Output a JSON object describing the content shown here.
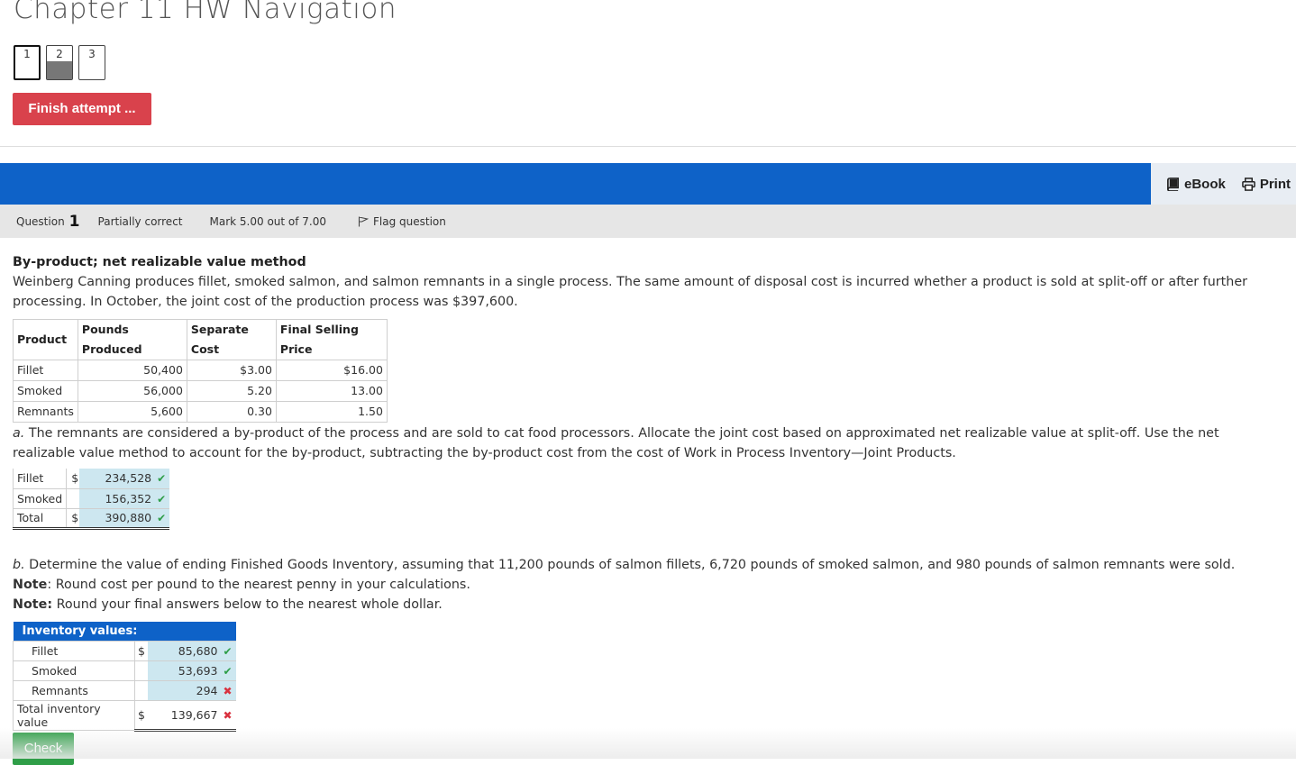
{
  "navigation": {
    "title": "Chapter 11 HW Navigation",
    "buttons": [
      "1",
      "2",
      "3"
    ],
    "finish_label": "Finish attempt ..."
  },
  "tools": {
    "ebook": "eBook",
    "print": "Print"
  },
  "question_info": {
    "label": "Question",
    "number": "1",
    "status": "Partially correct",
    "mark": "Mark 5.00 out of 7.00",
    "flag": "Flag question"
  },
  "question": {
    "heading": "By-product; net realizable value method",
    "text": "Weinberg Canning produces fillet, smoked salmon, and salmon remnants in a single process. The same amount of disposal cost is incurred whether a product is sold at split-off or after further processing. In October, the joint cost of the production process was $397,600.",
    "table": {
      "headers": [
        "Product",
        "Pounds Produced",
        "Separate Cost",
        "Final Selling Price"
      ],
      "rows": [
        [
          "Fillet",
          "50,400",
          "$3.00",
          "$16.00"
        ],
        [
          "Smoked",
          "56,000",
          "5.20",
          "13.00"
        ],
        [
          "Remnants",
          "5,600",
          "0.30",
          "1.50"
        ]
      ]
    }
  },
  "part_a": {
    "letter": "a.",
    "text": " The remnants are considered a by-product of the process and are sold to cat food processors. Allocate the joint cost based on approximated net realizable value at split-off. Use the net realizable value method to account for the by-product, subtracting the by-product cost from the cost of Work in Process Inventory—Joint Products.",
    "answers": [
      {
        "label": "Fillet",
        "currency": "$",
        "value": "234,528",
        "correct": true
      },
      {
        "label": "Smoked",
        "currency": "",
        "value": "156,352",
        "correct": true
      },
      {
        "label": "Total",
        "currency": "$",
        "value": "390,880",
        "correct": true
      }
    ]
  },
  "part_b": {
    "letter": "b.",
    "text": " Determine the value of ending Finished Goods Inventory, assuming that 11,200 pounds of salmon fillets, 6,720 pounds of smoked salmon, and 980 pounds of salmon remnants were sold.",
    "note1_label": "Note",
    "note1_text": ": Round cost per pound to the nearest penny in your calculations.",
    "note2_label": "Note:",
    "note2_text": " Round your final answers below to the nearest whole dollar.",
    "table_header": "Inventory values:",
    "answers": [
      {
        "label": "Fillet",
        "currency": "$",
        "value": "85,680",
        "correct": true
      },
      {
        "label": "Smoked",
        "currency": "",
        "value": "53,693",
        "correct": true
      },
      {
        "label": "Remnants",
        "currency": "",
        "value": "294",
        "correct": false
      },
      {
        "label": "Total inventory value",
        "currency": "$",
        "value": "139,667",
        "correct": false
      }
    ]
  },
  "check_label": "Check",
  "colors": {
    "accent_blue": "#0e62c8",
    "finish_red": "#d9424c",
    "check_green": "#2f9e48",
    "answer_bg": "#cde7f0"
  }
}
